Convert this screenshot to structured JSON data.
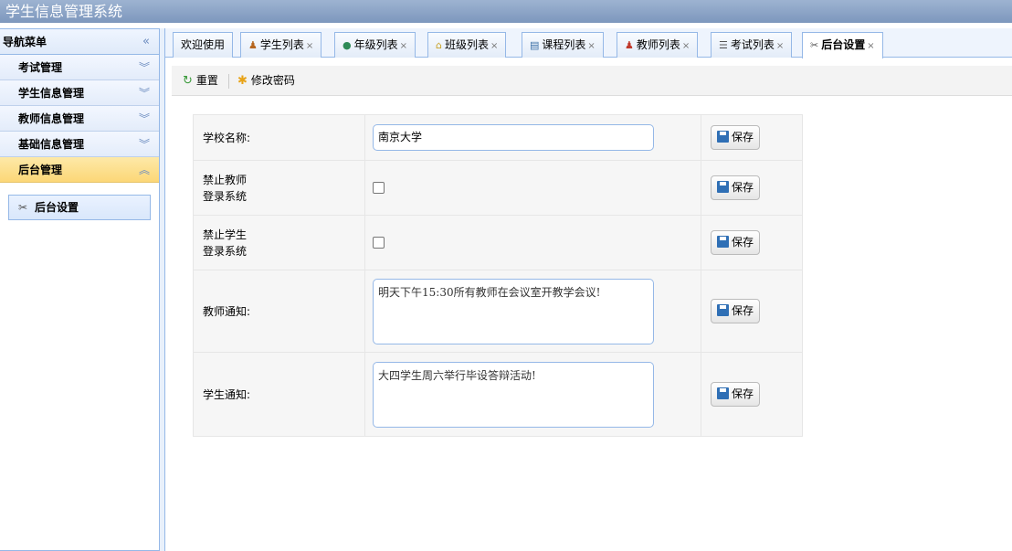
{
  "app": {
    "title": "学生信息管理系统"
  },
  "sidebar": {
    "title": "导航菜单",
    "collapse_glyph": "«",
    "sections": [
      {
        "label": "考试管理",
        "glyph": "︾"
      },
      {
        "label": "学生信息管理",
        "glyph": "︾"
      },
      {
        "label": "教师信息管理",
        "glyph": "︾"
      },
      {
        "label": "基础信息管理",
        "glyph": "︾"
      },
      {
        "label": "后台管理",
        "glyph": "︽"
      }
    ],
    "panel_item": {
      "label": "后台设置",
      "icon": "tools-icon"
    }
  },
  "tabs": [
    {
      "label": "欢迎使用",
      "icon": ""
    },
    {
      "label": "学生列表",
      "icon": "person-icon"
    },
    {
      "label": "年级列表",
      "icon": "globe-icon"
    },
    {
      "label": "班级列表",
      "icon": "house-icon"
    },
    {
      "label": "课程列表",
      "icon": "book-icon"
    },
    {
      "label": "教师列表",
      "icon": "person-icon"
    },
    {
      "label": "考试列表",
      "icon": "list-icon"
    },
    {
      "label": "后台设置",
      "icon": "tools-icon"
    }
  ],
  "tab_close": "×",
  "toolbar": {
    "reset_label": "重置",
    "change_password_label": "修改密码"
  },
  "form": {
    "school_name_label": "学校名称:",
    "school_name_value": "南京大学",
    "ban_teacher_label_1": "禁止教师",
    "ban_teacher_label_2": "登录系统",
    "ban_teacher_checked": false,
    "ban_student_label_1": "禁止学生",
    "ban_student_label_2": "登录系统",
    "ban_student_checked": false,
    "teacher_notice_label": "教师通知:",
    "teacher_notice_value": "明天下午15:30所有教师在会议室开教学会议!",
    "student_notice_label": "学生通知:",
    "student_notice_value": "大四学生周六举行毕设答辩活动!",
    "save_label": "保存"
  },
  "colors": {
    "border": "#95b8e7",
    "active_section": "#fcd777",
    "title_bar": "#8aa4c8"
  }
}
